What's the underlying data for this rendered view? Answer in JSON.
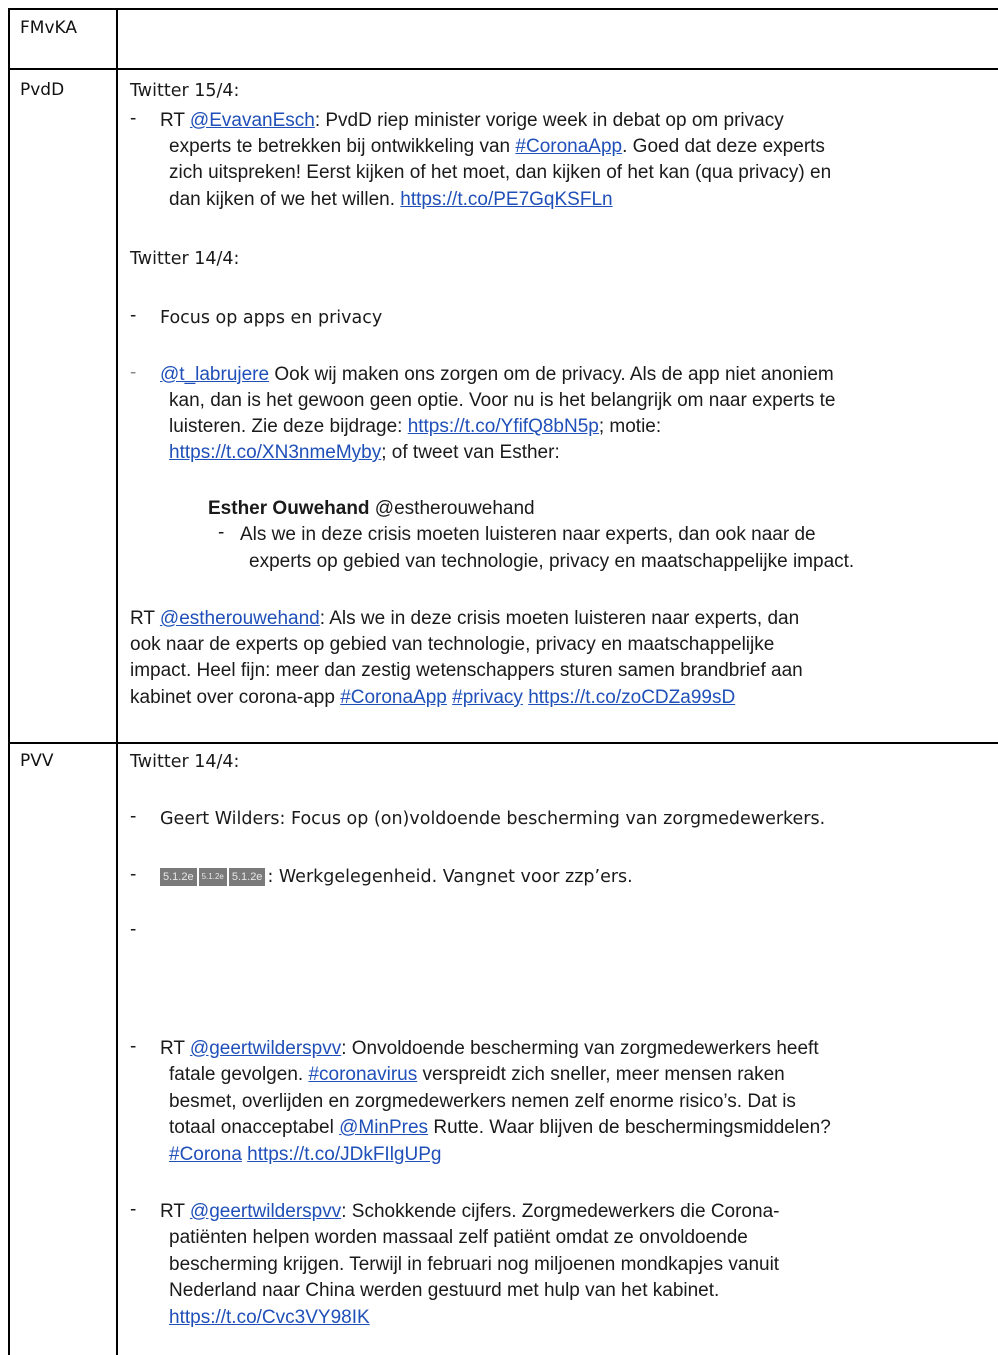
{
  "rows": {
    "fmvka": {
      "label": "FMvKA"
    },
    "pvdd": {
      "label": "PvdD",
      "h1": "Twitter 15/4:",
      "rt1": {
        "prefix": "RT ",
        "mention": "@EvavanEsch",
        "l1a": ": PvdD riep minister vorige week in debat op om privacy",
        "l2a": "experts te betrekken bij ontwikkeling van ",
        "l2tag": "#CoronaApp",
        "l2b": ". Goed dat deze experts",
        "l3": "zich uitspreken! Eerst kijken of het moet, dan kijken of het kan (qua privacy) en",
        "l4a": "dan kijken of we het willen. ",
        "l4link": "https://t.co/PE7GqKSFLn"
      },
      "h2": "Twitter 14/4:",
      "focus": "Focus op apps en privacy",
      "t2": {
        "mention": "@t_labrujere",
        "l1": " Ook wij maken ons zorgen om de privacy. Als de app niet anoniem",
        "l2": "kan, dan is het gewoon geen optie. Voor nu is het belangrijk om naar experts te",
        "l3a": "luisteren. Zie deze bijdrage: ",
        "l3link": "https://t.co/YfifQ8bN5p",
        "l3b": "; motie:",
        "l4link": "https://t.co/XN3nmeMyby",
        "l4b": "; of tweet van Esther:"
      },
      "quote": {
        "name": "Esther Ouwehand",
        "handle": " @estherouwehand",
        "l1": "Als we in deze crisis moeten luisteren naar experts, dan ook naar de",
        "l2": "experts op gebied van technologie, privacy en maatschappelijke impact."
      },
      "rt2": {
        "prefix": "RT ",
        "mention": "@estherouwehand",
        "l1": ": Als we in deze crisis moeten luisteren naar experts, dan",
        "l2": "ook naar de experts op gebied van technologie, privacy en maatschappelijke",
        "l3": "impact. Heel fijn: meer dan zestig wetenschappers sturen samen brandbrief aan",
        "l4a": "kabinet over corona-app ",
        "l4tag1": "#CoronaApp",
        "l4tag2": "#privacy",
        "l4link": "https://t.co/zoCDZa99sD"
      }
    },
    "pvv": {
      "label": "PVV",
      "h1": "Twitter 14/4:",
      "b1": "Geert Wilders: Focus op (on)voldoende bescherming van zorgmedewerkers.",
      "redactions": [
        "5.1.2e",
        "5.1.2e",
        "5.1.2e"
      ],
      "b2": ": Werkgelegenheid. Vangnet voor zzp’ers.",
      "b3": "-",
      "rt1": {
        "prefix": "RT ",
        "mention": "@geertwilderspvv",
        "l1": ": Onvoldoende bescherming van zorgmedewerkers heeft",
        "l2": "fatale gevolgen. ",
        "l2tag": "#coronavirus",
        "l2b": " verspreidt zich sneller, meer mensen raken",
        "l3": "besmet, overlijden en zorgmedewerkers nemen zelf enorme risico’s. Dat is",
        "l4a": "totaal onacceptabel ",
        "l4mention": "@MinPres",
        "l4b": " Rutte. Waar blijven de beschermingsmiddelen?",
        "l5tag": "#Corona",
        "l5link": "https://t.co/JDkFIlgUPg"
      },
      "rt2": {
        "prefix": "RT ",
        "mention": "@geertwilderspvv",
        "l1": ": Schokkende cijfers. Zorgmedewerkers die Corona-",
        "l2": "patiënten helpen worden massaal zelf patiënt omdat ze onvoldoende",
        "l3": "bescherming krijgen. Terwijl in februari nog miljoenen mondkapjes vanuit",
        "l4": "Nederland naar China werden gestuurd met hulp van het kabinet.",
        "l5link": "https://t.co/Cvc3VY98IK"
      }
    }
  }
}
